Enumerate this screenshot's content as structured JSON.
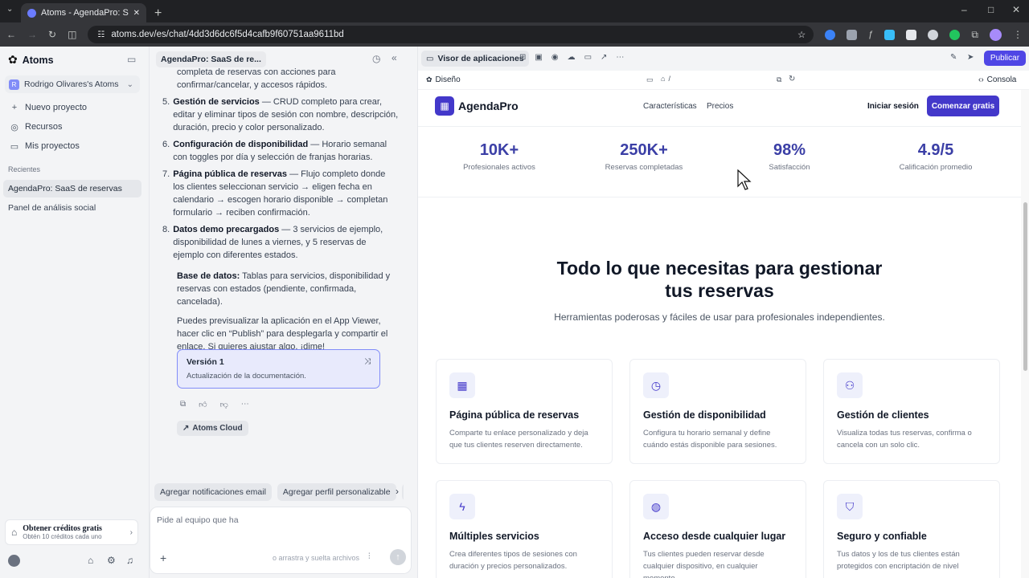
{
  "browser": {
    "tab_title": "Atoms - AgendaPro: SaaS de r",
    "url": "atoms.dev/es/chat/4dd3d6dc6f5d4cafb9f60751aa9611bd",
    "win_min": "–",
    "win_max": "□",
    "win_close": "✕"
  },
  "sidebar": {
    "brand": "Atoms",
    "workspace_initial": "R",
    "workspace": "Rodrigo Olivares's Atoms",
    "nav": [
      {
        "label": "Nuevo proyecto",
        "icon": "plus-icon"
      },
      {
        "label": "Recursos",
        "icon": "compass-icon"
      },
      {
        "label": "Mis proyectos",
        "icon": "folder-icon"
      }
    ],
    "recent_header": "Recientes",
    "recent": [
      "AgendaPro: SaaS de reservas",
      "Panel de análisis social"
    ],
    "credits_title": "Obtener créditos gratis",
    "credits_sub": "Obtén 10 créditos cada uno"
  },
  "chat": {
    "title": "AgendaPro: SaaS de re...",
    "intro_tail": "completa de reservas con acciones para confirmar/cancelar, y accesos rápidos.",
    "items": [
      {
        "n": "5.",
        "bold": "Gestión de servicios",
        "text": " — CRUD completo para crear, editar y eliminar tipos de sesión con nombre, descripción, duración, precio y color personalizado."
      },
      {
        "n": "6.",
        "bold": "Configuración de disponibilidad",
        "text": " — Horario semanal con toggles por día y selección de franjas horarias."
      },
      {
        "n": "7.",
        "bold": "Página pública de reservas",
        "text": " — Flujo completo donde los clientes seleccionan servicio → eligen fecha en calendario → escogen horario disponible → completan formulario → reciben confirmación."
      },
      {
        "n": "8.",
        "bold": "Datos demo precargados",
        "text": " — 3 servicios de ejemplo, disponibilidad de lunes a viernes, y 5 reservas de ejemplo con diferentes estados."
      }
    ],
    "db_bold": "Base de datos:",
    "db_text": " Tablas para servicios, disponibilidad y reservas con estados (pendiente, confirmada, cancelada).",
    "closing": "Puedes previsualizar la aplicación en el App Viewer, hacer clic en “Publish” para desplegarla y compartir el enlace. Si quieres ajustar algo, ¡dime!",
    "version_title": "Versión 1",
    "version_sub": "Actualización de la documentación.",
    "cloud_label": "Atoms Cloud",
    "suggestions": [
      "Agregar notificaciones email",
      "Agregar perfil personalizable",
      "A"
    ],
    "input_placeholder": "Pide al equipo que ha",
    "input_hint": "o arrastra y suelta archivos"
  },
  "viewer": {
    "title": "Visor de aplicaciones",
    "publish": "Publicar",
    "design": "Diseño",
    "path": "/",
    "console": "Consola",
    "app": {
      "brand": "AgendaPro",
      "nav": [
        "Características",
        "Precios"
      ],
      "login": "Iniciar sesión",
      "cta": "Comenzar gratis",
      "accent": "#4338ca",
      "stats": [
        {
          "value": "10K+",
          "label": "Profesionales activos"
        },
        {
          "value": "250K+",
          "label": "Reservas completadas"
        },
        {
          "value": "98%",
          "label": "Satisfacción"
        },
        {
          "value": "4.9/5",
          "label": "Calificación promedio"
        }
      ],
      "heading_line1": "Todo lo que necesitas para gestionar",
      "heading_line2": "tus reservas",
      "subheading": "Herramientas poderosas y fáciles de usar para profesionales independientes.",
      "features": [
        {
          "title": "Página pública de reservas",
          "desc": "Comparte tu enlace personalizado y deja que tus clientes reserven directamente.",
          "icon": "calendar-icon"
        },
        {
          "title": "Gestión de disponibilidad",
          "desc": "Configura tu horario semanal y define cuándo estás disponible para sesiones.",
          "icon": "clock-icon"
        },
        {
          "title": "Gestión de clientes",
          "desc": "Visualiza todas tus reservas, confirma o cancela con un solo clic.",
          "icon": "users-icon"
        },
        {
          "title": "Múltiples servicios",
          "desc": "Crea diferentes tipos de sesiones con duración y precios personalizados.",
          "icon": "bolt-icon"
        },
        {
          "title": "Acceso desde cualquier lugar",
          "desc": "Tus clientes pueden reservar desde cualquier dispositivo, en cualquier momento.",
          "icon": "globe-icon"
        },
        {
          "title": "Seguro y confiable",
          "desc": "Tus datos y los de tus clientes están protegidos con encriptación de nivel",
          "icon": "shield-icon"
        }
      ]
    }
  }
}
